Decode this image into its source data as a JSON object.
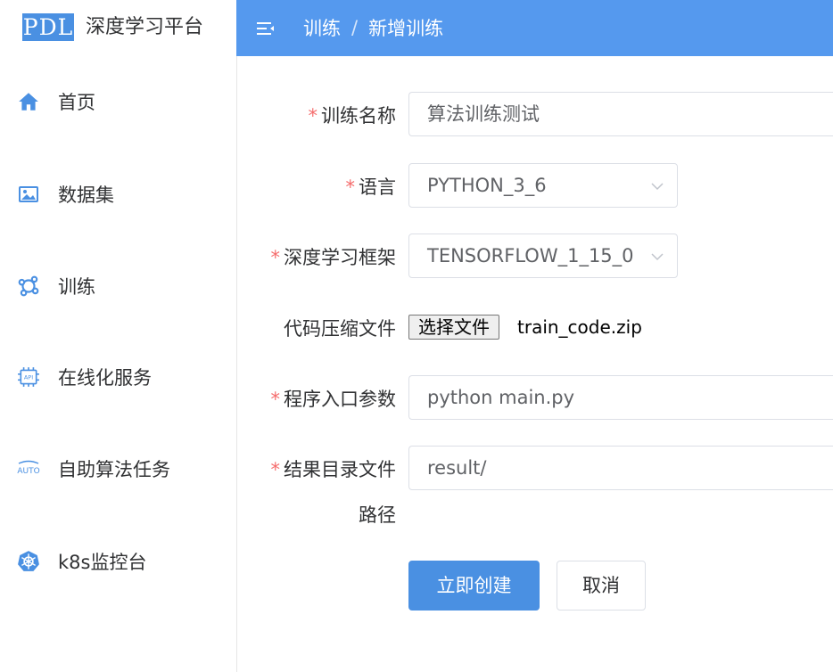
{
  "brand": {
    "logo_text": "PDL",
    "title": "深度学习平台"
  },
  "sidebar": {
    "items": [
      {
        "label": "首页",
        "icon": "home-icon"
      },
      {
        "label": "数据集",
        "icon": "image-icon"
      },
      {
        "label": "训练",
        "icon": "nodes-icon"
      },
      {
        "label": "在线化服务",
        "icon": "api-chip-icon"
      },
      {
        "label": "自助算法任务",
        "icon": "auto-icon"
      },
      {
        "label": "k8s监控台",
        "icon": "kubernetes-icon"
      }
    ]
  },
  "header": {
    "breadcrumb": [
      "训练",
      "新增训练"
    ],
    "separator": "/"
  },
  "form": {
    "name": {
      "label": "训练名称",
      "value": "算法训练测试",
      "required": true
    },
    "language": {
      "label": "语言",
      "value": "PYTHON_3_6",
      "required": true
    },
    "framework": {
      "label": "深度学习框架",
      "value": "TENSORFLOW_1_15_0",
      "required": true
    },
    "code_file": {
      "label": "代码压缩文件",
      "button_label": "选择文件",
      "file_name": "train_code.zip",
      "required": false
    },
    "entry": {
      "label": "程序入口参数",
      "value": "python main.py",
      "required": true
    },
    "result_path": {
      "label_line1": "结果目录文件",
      "label_line2": "路径",
      "value": "result/",
      "required": true
    },
    "required_mark": "*"
  },
  "actions": {
    "create_label": "立即创建",
    "cancel_label": "取消"
  },
  "colors": {
    "header_bg": "#5599ee",
    "primary": "#4a90e2",
    "required": "#f56c6c"
  }
}
